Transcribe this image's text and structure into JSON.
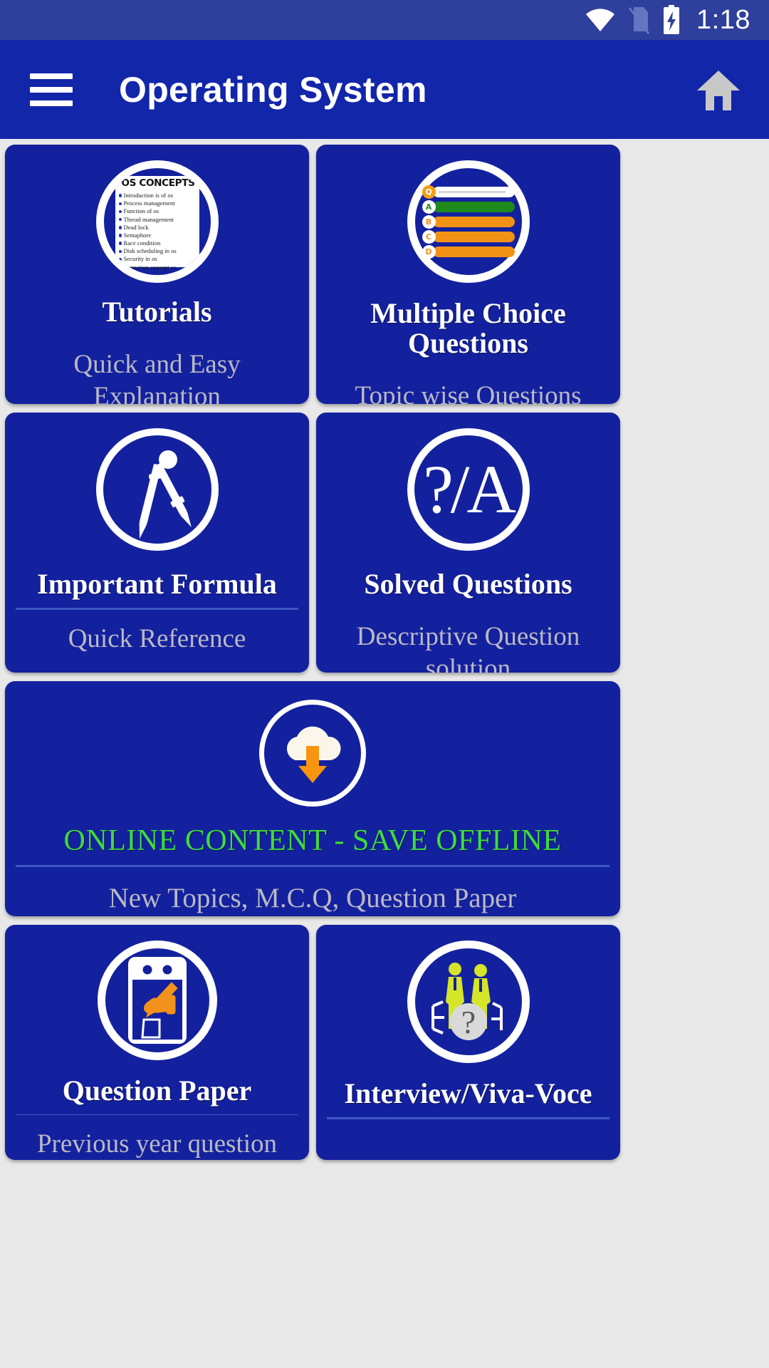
{
  "status_bar": {
    "time": "1:18",
    "icons": [
      "wifi-icon",
      "no-sim-icon",
      "battery-charging-icon"
    ],
    "background": "#2e409b"
  },
  "app_bar": {
    "menu_icon": "hamburger-menu-icon",
    "title": "Operating System",
    "home_icon": "home-icon",
    "background": "#1226aa",
    "home_icon_color": "#c8c8c8"
  },
  "theme": {
    "card_background": "#14219e",
    "page_background": "#e8e8e8",
    "title_color": "#ffffff",
    "subtitle_color": "#b9b9c4",
    "divider_color": "#3f56c4",
    "accent_green": "#3ddd3d",
    "accent_orange": "#f29215"
  },
  "cards": [
    {
      "id": "tutorials",
      "icon": "os-concepts-list-icon",
      "title": "Tutorials",
      "subtitle": "Quick and Easy Explanation",
      "icon_content": {
        "heading": "OS CONCEPTS",
        "items": [
          "Introduction is of os",
          "Process management",
          "Function of os",
          "Thread management",
          "Dead lock",
          "Semaphore",
          "Race condition",
          "Disk scheduling in os",
          "Security in os",
          "Protection concept os"
        ]
      }
    },
    {
      "id": "mcq",
      "icon": "multiple-choice-list-icon",
      "title": "Multiple Choice Questions",
      "subtitle": "Topic wise Questions",
      "icon_content": {
        "rows": [
          "Q",
          "A",
          "B",
          "C",
          "D"
        ]
      }
    },
    {
      "id": "important-formula",
      "icon": "compass-divider-icon",
      "title": "Important Formula",
      "subtitle": "Quick Reference"
    },
    {
      "id": "solved-questions",
      "icon": "question-answer-icon",
      "title": "Solved Questions",
      "subtitle": "Descriptive Question solution",
      "icon_content": {
        "glyph": "?/A"
      }
    },
    {
      "id": "online-content",
      "icon": "cloud-download-icon",
      "title": "ONLINE CONTENT - SAVE OFFLINE",
      "subtitle": "New Topics, M.C.Q, Question Paper",
      "title_color": "#3ddd3d"
    },
    {
      "id": "question-paper",
      "icon": "hand-writing-paper-icon",
      "title": "Question Paper",
      "subtitle": "Previous year question"
    },
    {
      "id": "interview",
      "icon": "interview-people-icon",
      "title": "Interview/Viva-Voce",
      "subtitle": ""
    }
  ]
}
